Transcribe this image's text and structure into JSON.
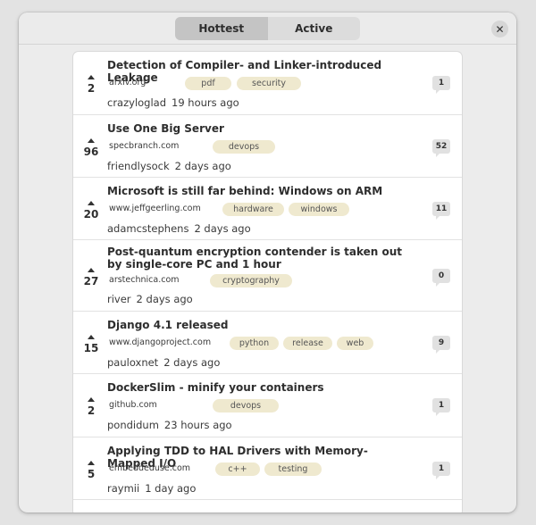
{
  "tabs": [
    {
      "label": "Hottest",
      "active": true
    },
    {
      "label": "Active",
      "active": false
    }
  ],
  "close_glyph": "✕",
  "stories": [
    {
      "votes": "2",
      "title": "Detection of Compiler- and Linker-introduced Leakage",
      "domain": "arxiv.org",
      "tags": [
        "pdf",
        "security"
      ],
      "author": "crazyloglad",
      "time": "19 hours ago",
      "comments": "1"
    },
    {
      "votes": "96",
      "title": "Use One Big Server",
      "domain": "specbranch.com",
      "tags": [
        "devops"
      ],
      "author": "friendlysock",
      "time": "2 days ago",
      "comments": "52"
    },
    {
      "votes": "20",
      "title": "Microsoft is still far behind: Windows on ARM",
      "domain": "www.jeffgeerling.com",
      "tags": [
        "hardware",
        "windows"
      ],
      "author": "adamcstephens",
      "time": "2 days ago",
      "comments": "11"
    },
    {
      "votes": "27",
      "title": "Post-quantum encryption contender is taken out by single-core PC and 1 hour",
      "domain": "arstechnica.com",
      "tags": [
        "cryptography"
      ],
      "author": "river",
      "time": "2 days ago",
      "comments": "0"
    },
    {
      "votes": "15",
      "title": "Django 4.1 released",
      "domain": "www.djangoproject.com",
      "tags": [
        "python",
        "release",
        "web"
      ],
      "author": "pauloxnet",
      "time": "2 days ago",
      "comments": "9"
    },
    {
      "votes": "2",
      "title": "DockerSlim - minify your containers",
      "domain": "github.com",
      "tags": [
        "devops"
      ],
      "author": "pondidum",
      "time": "23 hours ago",
      "comments": "1"
    },
    {
      "votes": "5",
      "title": "Applying TDD to HAL Drivers with Memory-Mapped I/O",
      "domain": "embeddeduse.com",
      "tags": [
        "c++",
        "testing"
      ],
      "author": "raymii",
      "time": "1 day ago",
      "comments": "1"
    }
  ],
  "icons": {
    "upvote": "upvote-arrow-icon",
    "comments": "comment-bubble-icon",
    "close": "close-icon"
  }
}
